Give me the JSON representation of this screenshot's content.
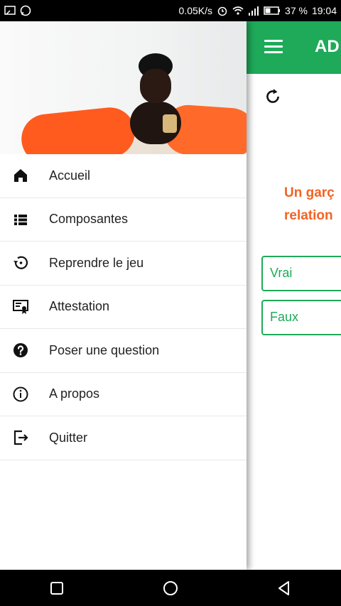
{
  "status_bar": {
    "network_speed": "0.05K/s",
    "battery": "37 %",
    "time": "19:04"
  },
  "app": {
    "title": "AD",
    "question_lines": [
      "Un garç",
      "relation"
    ],
    "answers": {
      "true_label": "Vrai",
      "false_label": "Faux"
    }
  },
  "drawer": {
    "items": [
      {
        "label": "Accueil",
        "icon": "home-icon"
      },
      {
        "label": "Composantes",
        "icon": "list-icon"
      },
      {
        "label": "Reprendre le jeu",
        "icon": "restore-icon"
      },
      {
        "label": "Attestation",
        "icon": "certificate-icon"
      },
      {
        "label": "Poser une question",
        "icon": "help-icon"
      },
      {
        "label": "A propos",
        "icon": "info-icon"
      },
      {
        "label": "Quitter",
        "icon": "exit-icon"
      }
    ]
  },
  "colors": {
    "primary": "#1faa59",
    "accent": "#f26322"
  }
}
